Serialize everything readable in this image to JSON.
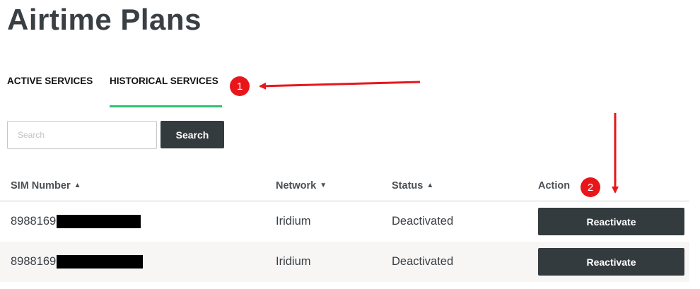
{
  "page": {
    "title": "Airtime Plans"
  },
  "tabs": [
    {
      "label": "ACTIVE SERVICES",
      "active": false
    },
    {
      "label": "HISTORICAL SERVICES",
      "active": true
    }
  ],
  "search": {
    "placeholder": "Search",
    "value": "",
    "button_label": "Search"
  },
  "table": {
    "columns": [
      {
        "label": "SIM Number",
        "sort": "sort-up-icon"
      },
      {
        "label": "Network",
        "sort": "sort-down-icon"
      },
      {
        "label": "Status",
        "sort": "sort-up-icon"
      },
      {
        "label": "Action",
        "sort": ""
      }
    ],
    "rows": [
      {
        "sim_prefix": "8988169",
        "network": "Iridium",
        "status": "Deactivated",
        "action": "Reactivate"
      },
      {
        "sim_prefix": "8988169",
        "network": "Iridium",
        "status": "Deactivated",
        "action": "Reactivate"
      }
    ]
  },
  "annotations": [
    {
      "label": "1"
    },
    {
      "label": "2"
    }
  ],
  "colors": {
    "tab_indicator": "#2fbf71",
    "button_bg": "#343b3f",
    "annotation": "#e8161b",
    "alt_row_bg": "#f7f6f5"
  }
}
